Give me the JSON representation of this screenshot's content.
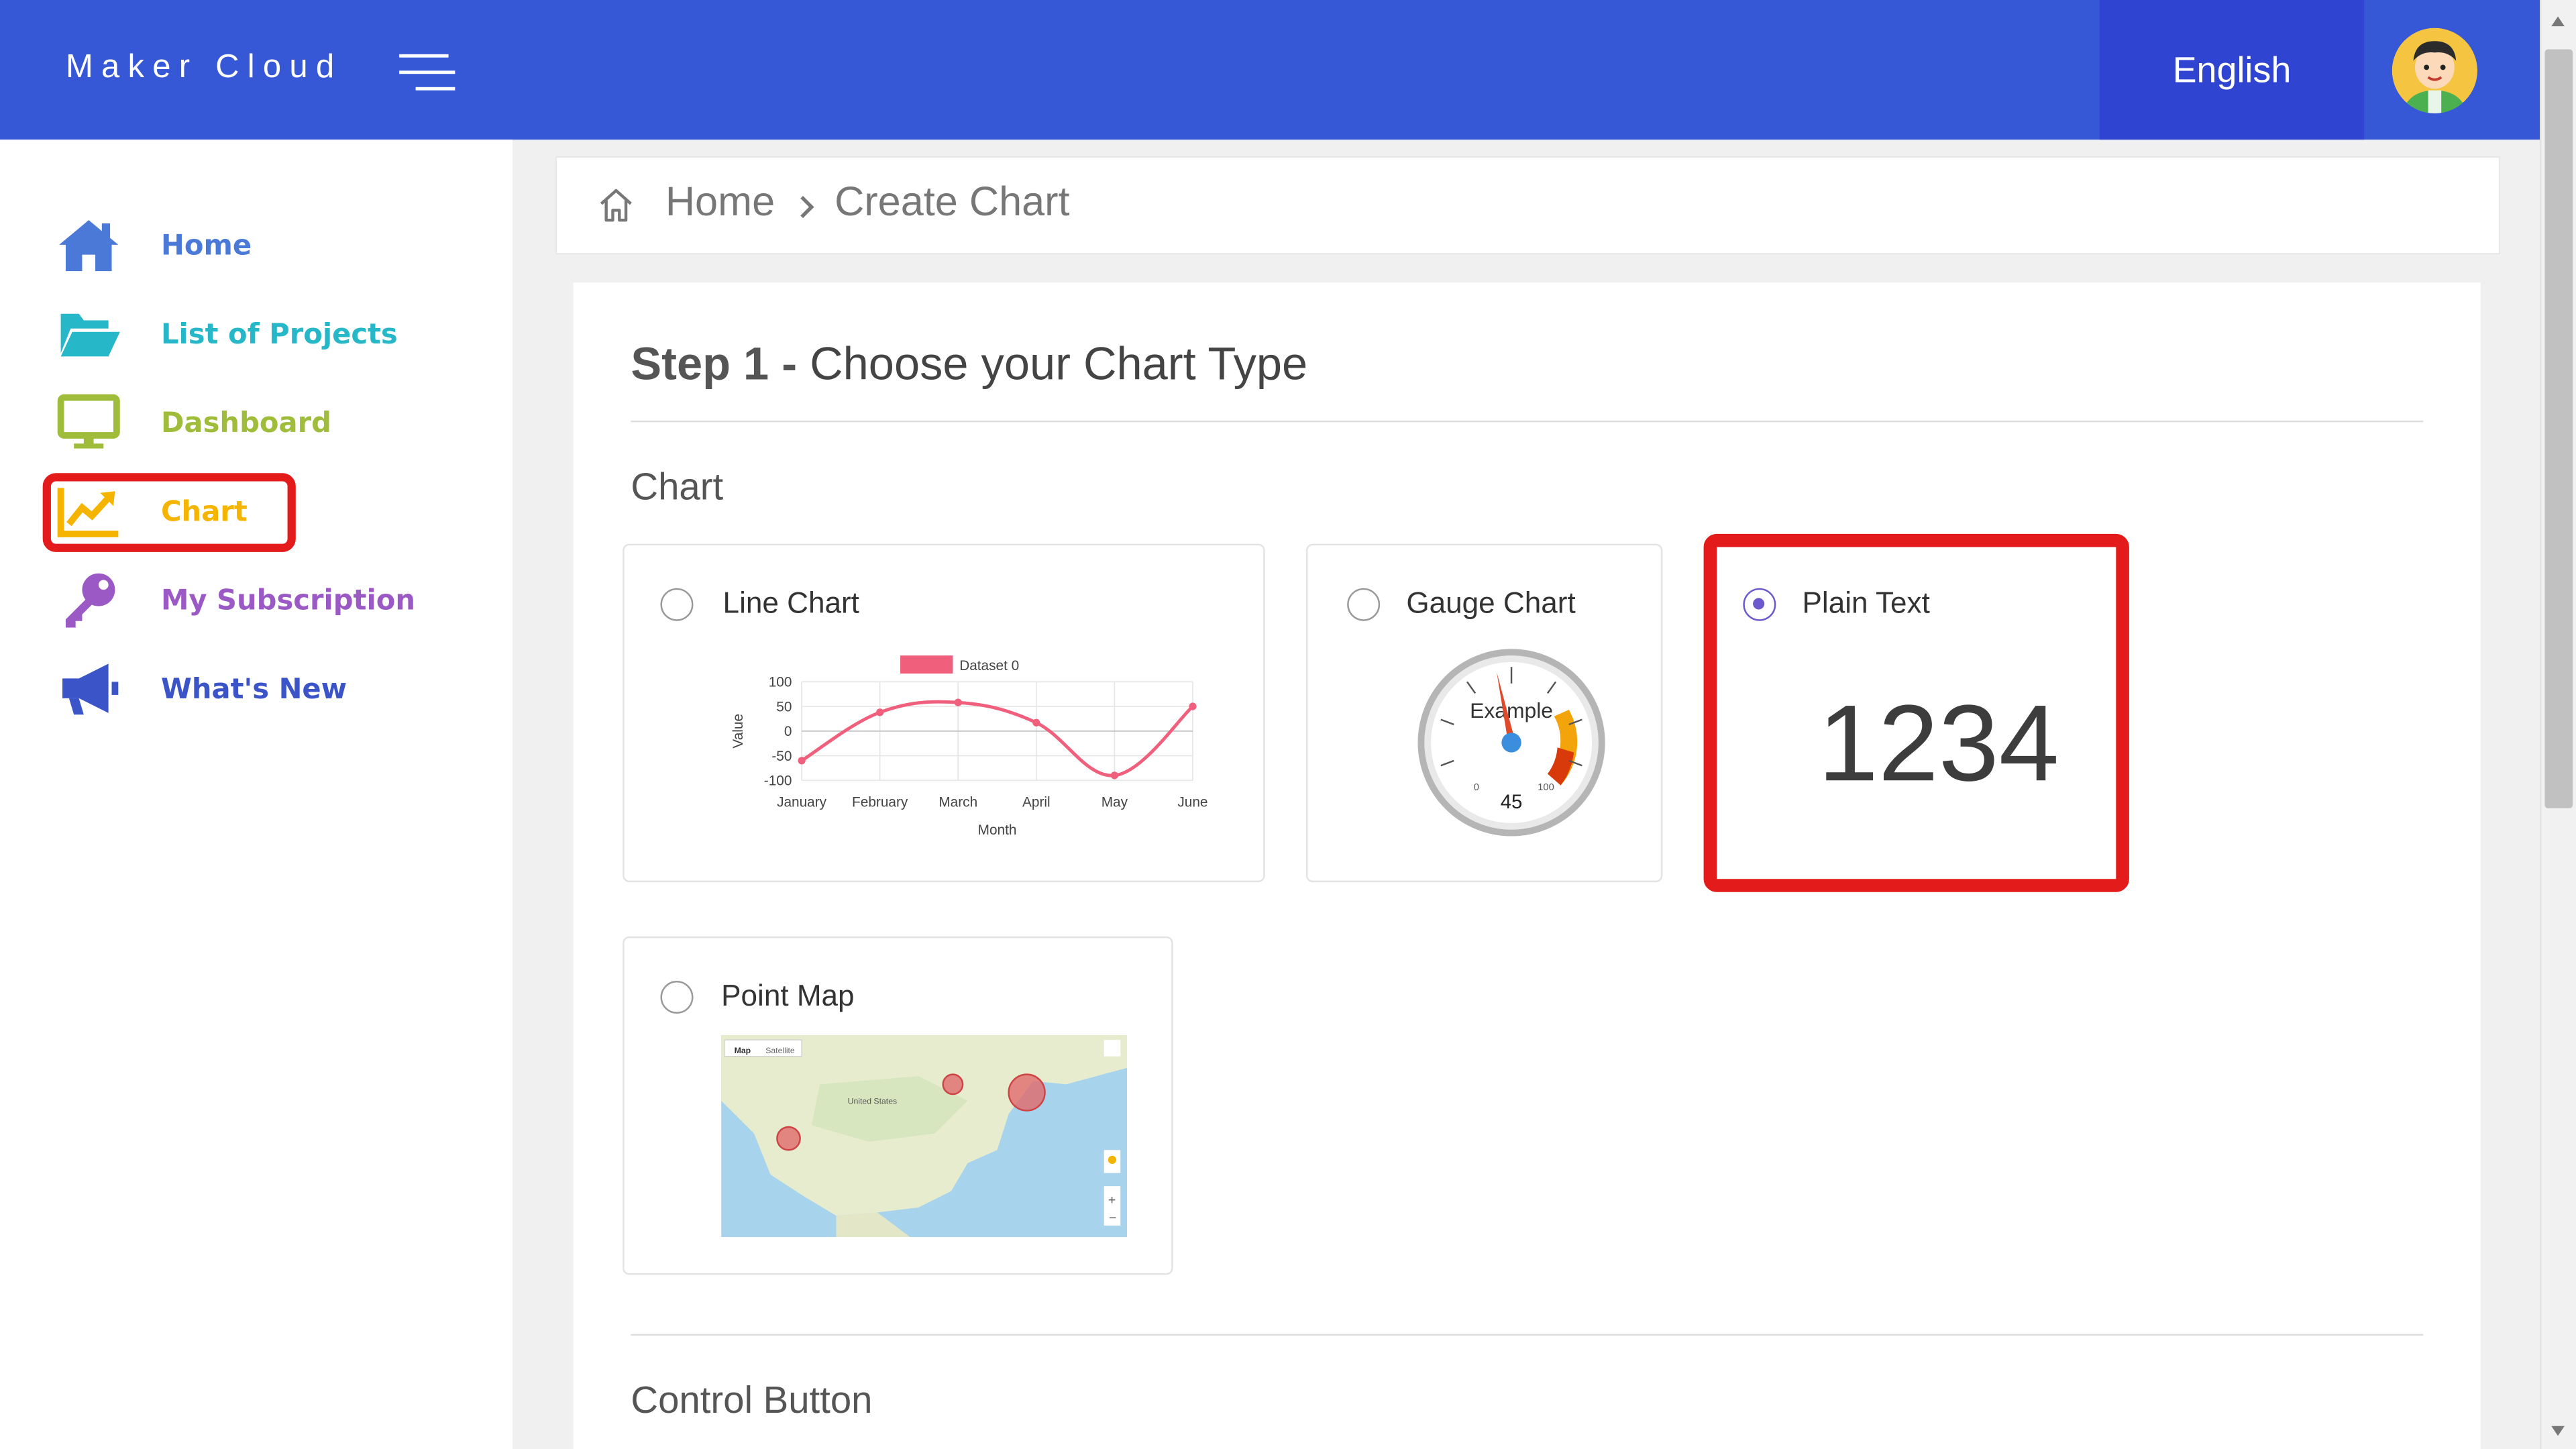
{
  "app": {
    "brand": "Maker Cloud",
    "language": "English"
  },
  "sidebar": {
    "items": [
      {
        "label": "Home",
        "icon": "home-icon",
        "color": "#4a79d8"
      },
      {
        "label": "List of Projects",
        "icon": "folder-open-icon",
        "color": "#26b7c9"
      },
      {
        "label": "Dashboard",
        "icon": "monitor-icon",
        "color": "#9fbd3a"
      },
      {
        "label": "Chart",
        "icon": "trending-chart-icon",
        "color": "#f5b400"
      },
      {
        "label": "My Subscription",
        "icon": "key-icon",
        "color": "#9b59c5"
      },
      {
        "label": "What's New",
        "icon": "megaphone-icon",
        "color": "#3b55c9"
      }
    ],
    "selected": "Chart"
  },
  "breadcrumb": {
    "home": "Home",
    "current": "Create Chart"
  },
  "step": {
    "number_label": "Step 1",
    "separator": "-",
    "title": "Choose your Chart Type"
  },
  "sections": {
    "chart": "Chart",
    "control": "Control Button"
  },
  "options": {
    "line": {
      "label": "Line Chart",
      "selected": false
    },
    "gauge": {
      "label": "Gauge Chart",
      "selected": false
    },
    "plain": {
      "label": "Plain Text",
      "selected": true
    },
    "map": {
      "label": "Point Map",
      "selected": false
    }
  },
  "plain_preview": {
    "value": "1234"
  },
  "gauge_preview": {
    "label": "Example",
    "value": "45",
    "min": "0",
    "max": "100"
  },
  "map_preview": {
    "tabs": [
      "Map",
      "Satellite"
    ],
    "country_label": "United States"
  },
  "chart_data": {
    "type": "line",
    "categories": [
      "January",
      "February",
      "March",
      "April",
      "May",
      "June"
    ],
    "series": [
      {
        "name": "Dataset 0",
        "values": [
          -60,
          38,
          58,
          17,
          -90,
          50
        ],
        "color": "#f0607c"
      }
    ],
    "xlabel": "Month",
    "ylabel": "Value",
    "yticks": [
      100,
      50,
      0,
      -50,
      -100
    ],
    "ylim": [
      -100,
      100
    ],
    "legend": "top"
  },
  "colors": {
    "topbar": "#3657d6",
    "language_button": "#2f44d0",
    "highlight": "#e41b1b",
    "radio_selected": "#6a5acd"
  }
}
